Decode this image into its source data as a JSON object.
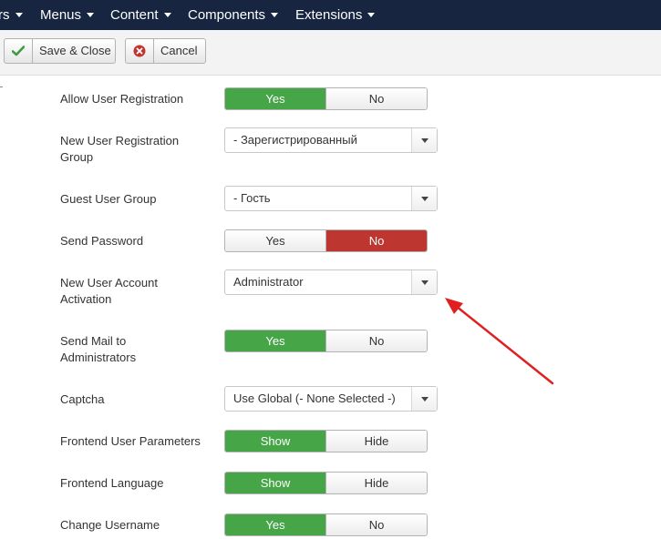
{
  "navbar": {
    "items": [
      "rs",
      "Menus",
      "Content",
      "Components",
      "Extensions"
    ]
  },
  "toolbar": {
    "save_close_label": "Save & Close",
    "cancel_label": "Cancel"
  },
  "form": {
    "allow_registration": {
      "label": "Allow User Registration",
      "opt1": "Yes",
      "opt2": "No",
      "selected": "Yes"
    },
    "new_user_group": {
      "label": "New User Registration Group",
      "value": "- Зарегистрированный"
    },
    "guest_group": {
      "label": "Guest User Group",
      "value": "- Гость"
    },
    "send_password": {
      "label": "Send Password",
      "opt1": "Yes",
      "opt2": "No",
      "selected": "No"
    },
    "account_activation": {
      "label": "New User Account Activation",
      "value": "Administrator"
    },
    "send_mail_admins": {
      "label": "Send Mail to Administrators",
      "opt1": "Yes",
      "opt2": "No",
      "selected": "Yes"
    },
    "captcha": {
      "label": "Captcha",
      "value": "Use Global (- None Selected -)"
    },
    "frontend_params": {
      "label": "Frontend User Parameters",
      "opt1": "Show",
      "opt2": "Hide",
      "selected": "Show"
    },
    "frontend_language": {
      "label": "Frontend Language",
      "opt1": "Show",
      "opt2": "Hide",
      "selected": "Show"
    },
    "change_username": {
      "label": "Change Username",
      "opt1": "Yes",
      "opt2": "No",
      "selected": "Yes"
    }
  },
  "colors": {
    "navbar": "#172541",
    "toggle_on_green": "#46a546",
    "toggle_on_red": "#bd362f",
    "annotation_arrow": "#e02020"
  }
}
